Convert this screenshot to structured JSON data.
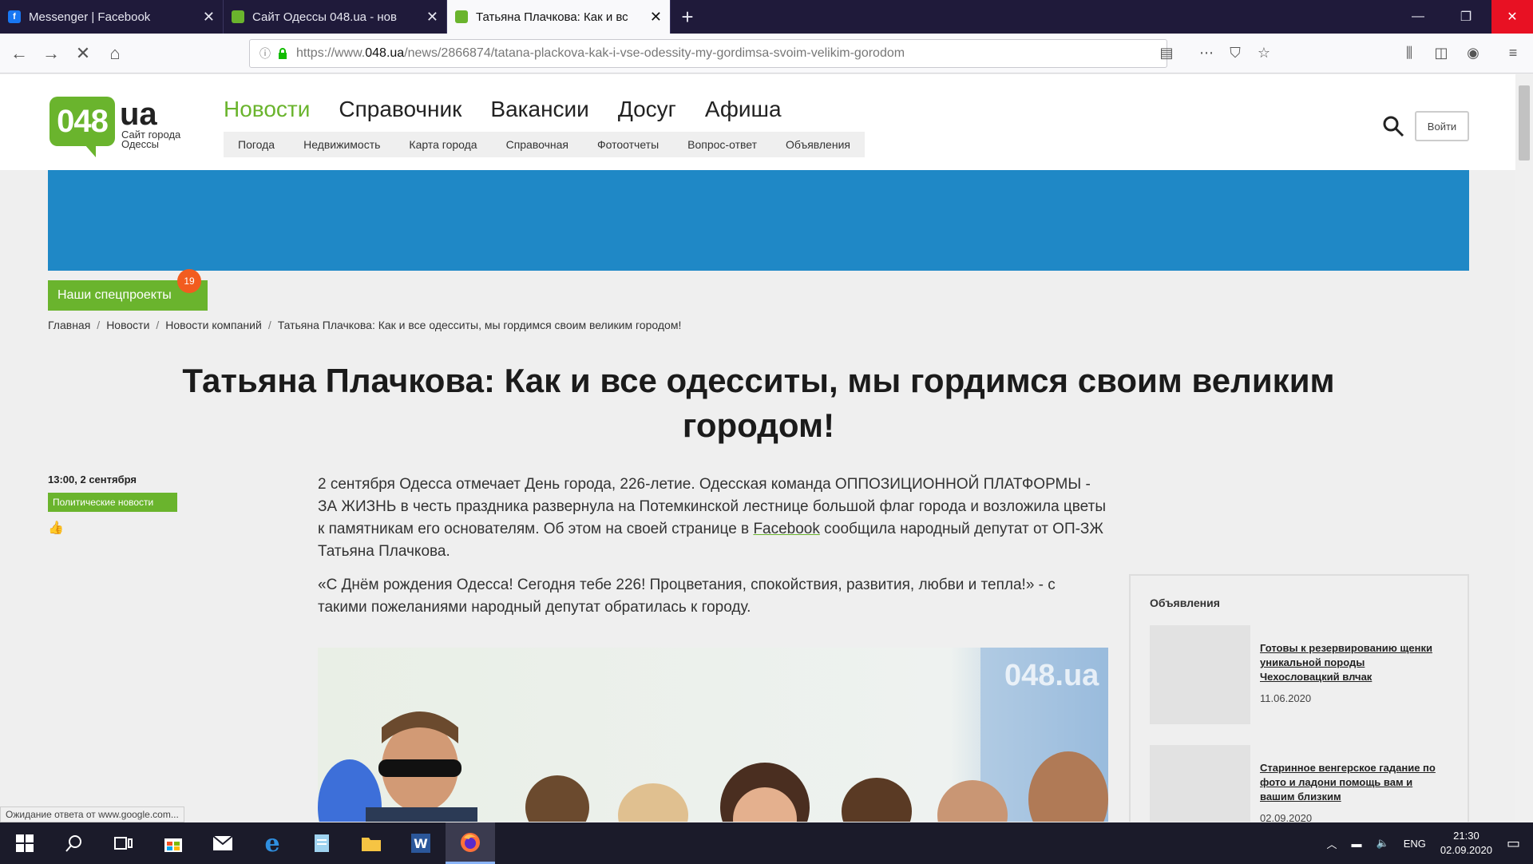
{
  "browser": {
    "tabs": [
      {
        "title": "Messenger | Facebook",
        "icon": "facebook-icon",
        "active": false
      },
      {
        "title": "Сайт Одессы 048.ua - нов",
        "icon": "048-icon",
        "active": false
      },
      {
        "title": "Татьяна Плачкова: Как и вс",
        "icon": "048-icon",
        "active": true
      }
    ],
    "url_prefix": "https://www.",
    "url_domain": "048.ua",
    "url_path": "/news/2866874/tatana-plackova-kak-i-vse-odessity-my-gordimsa-svoim-velikim-gorodom",
    "status_text": "Ожидание ответа от www.google.com..."
  },
  "site": {
    "logo_number": "048",
    "logo_suffix": "ua",
    "logo_tagline": "Сайт города Одессы",
    "main_nav": [
      "Новости",
      "Справочник",
      "Вакансии",
      "Досуг",
      "Афиша"
    ],
    "sub_nav": [
      "Погода",
      "Недвижимость",
      "Карта города",
      "Справочная",
      "Фотоотчеты",
      "Вопрос-ответ",
      "Объявления"
    ],
    "login_label": "Войти",
    "special_label": "Наши спецпроекты",
    "special_count": "19",
    "accent_color": "#6ab42d",
    "banner_color": "#1f88c6"
  },
  "breadcrumb": [
    "Главная",
    "Новости",
    "Новости компаний",
    "Татьяна Плачкова: Как и все одесситы, мы гордимся своим великим городом!"
  ],
  "article": {
    "title_line1": "Татьяна Плачкова: Как и все одесситы, мы гордимся своим великим",
    "title_line2": "городом!",
    "date": "13:00, 2 сентября",
    "category": "Политические новости",
    "p1_before": "2 сентября Одесса отмечает День города, 226-летие. Одесская команда ОППОЗИЦИОННОЙ ПЛАТФОРМЫ - ЗА ЖИЗНЬ в честь праздника развернула на Потемкинской лестнице большой флаг города и возложила цветы к памятникам его основателям. Об этом на своей странице в ",
    "p1_link": "Facebook",
    "p1_after": " сообщила народный депутат от ОП-ЗЖ Татьяна Плачкова.",
    "p2": "«С Днём рождения Одесса! Сегодня тебе 226! Процветания, спокойствия, развития, любви и тепла!» - с такими пожеланиями народный депутат обратилась к городу.",
    "photo_watermark": "048.ua"
  },
  "sidebar": {
    "title": "Объявления",
    "items": [
      {
        "title": "Готовы к резервированию щенки уникальной породы Чехословацкий влчак",
        "date": "11.06.2020"
      },
      {
        "title": "Старинное венгерское гадание по фото и ладони помощь вам и вашим близким",
        "date": "02.09.2020"
      }
    ]
  },
  "taskbar": {
    "lang": "ENG",
    "time": "21:30",
    "date": "02.09.2020"
  }
}
